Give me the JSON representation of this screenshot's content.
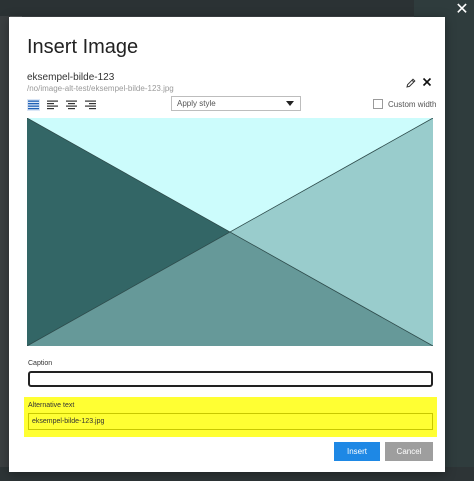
{
  "dialog": {
    "title": "Insert Image",
    "close_symbol": "✕"
  },
  "image": {
    "name": "eksempel-bilde-123",
    "path": "/no/image-alt-test/eksempel-bilde-123.jpg"
  },
  "toolbar": {
    "align_buttons": [
      "align-left-active-icon",
      "align-left-icon",
      "align-center-icon",
      "align-right-icon"
    ],
    "style_select_value": "Apply style",
    "custom_width_label": "Custom width",
    "custom_width_checked": false
  },
  "caption": {
    "label": "Caption",
    "value": ""
  },
  "alt_text": {
    "label": "Alternative text",
    "value": "eksempel-bilde-123.jpg"
  },
  "actions": {
    "insert_label": "Insert",
    "cancel_label": "Cancel"
  },
  "colors": {
    "accent": "#1e88e5",
    "highlight": "#ffff33",
    "preview_top": "#ccfcfc",
    "preview_left": "#336666",
    "preview_right": "#99cccc",
    "preview_bottom": "#669999"
  }
}
